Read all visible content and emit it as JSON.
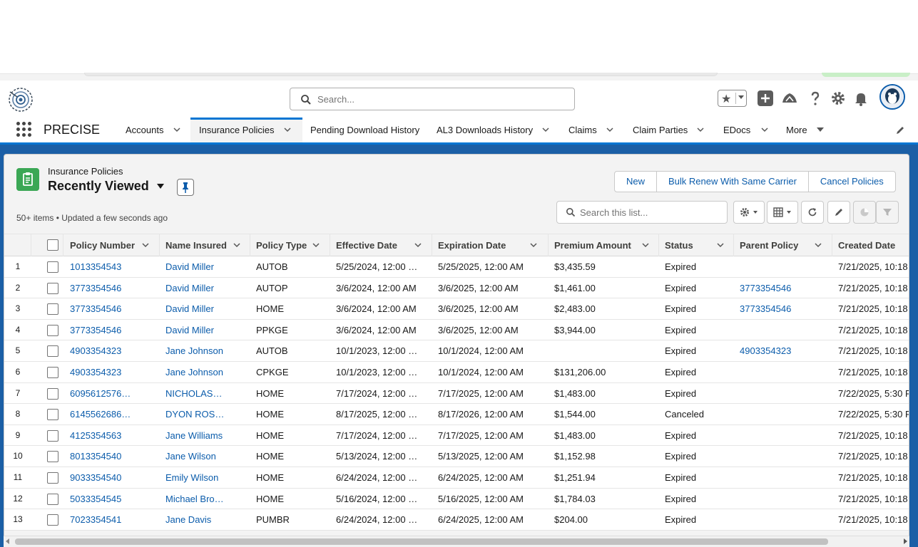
{
  "header": {
    "search_placeholder": "Search...",
    "icons": [
      "star-icon",
      "add-icon",
      "trailhead-icon",
      "help-icon",
      "setup-gear-icon",
      "notifications-bell-icon",
      "avatar"
    ]
  },
  "nav": {
    "app_name": "PRECISE",
    "items": [
      {
        "label": "Accounts",
        "has_menu": true,
        "active": false
      },
      {
        "label": "Insurance Policies",
        "has_menu": true,
        "active": true
      },
      {
        "label": "Pending Download History",
        "has_menu": false,
        "active": false
      },
      {
        "label": "AL3 Downloads History",
        "has_menu": true,
        "active": false
      },
      {
        "label": "Claims",
        "has_menu": true,
        "active": false
      },
      {
        "label": "Claim Parties",
        "has_menu": true,
        "active": false
      },
      {
        "label": "EDocs",
        "has_menu": true,
        "active": false
      },
      {
        "label": "More",
        "has_menu": true,
        "active": false
      }
    ]
  },
  "list": {
    "object_label": "Insurance Policies",
    "view_name": "Recently Viewed",
    "meta": "50+ items • Updated a few seconds ago",
    "buttons": [
      "New",
      "Bulk Renew With Same Carrier",
      "Cancel Policies"
    ],
    "search_placeholder": "Search this list...",
    "columns": [
      "Policy Number",
      "Name Insured",
      "Policy Type",
      "Effective Date",
      "Expiration Date",
      "Premium Amount",
      "Status",
      "Parent Policy",
      "Created Date"
    ],
    "rows": [
      {
        "n": "1",
        "policy": "1013354543",
        "insured": "David Miller",
        "type": "AUTOB",
        "eff": "5/25/2024, 12:00 …",
        "exp": "5/25/2025, 12:00 AM",
        "premium": "$3,435.59",
        "status": "Expired",
        "parent": "",
        "created": "7/21/2025, 10:18"
      },
      {
        "n": "2",
        "policy": "3773354546",
        "insured": "David Miller",
        "type": "AUTOP",
        "eff": "3/6/2024, 12:00 AM",
        "exp": "3/6/2025, 12:00 AM",
        "premium": "$1,461.00",
        "status": "Expired",
        "parent": "3773354546",
        "created": "7/21/2025, 10:18"
      },
      {
        "n": "3",
        "policy": "3773354546",
        "insured": "David Miller",
        "type": "HOME",
        "eff": "3/6/2024, 12:00 AM",
        "exp": "3/6/2025, 12:00 AM",
        "premium": "$2,483.00",
        "status": "Expired",
        "parent": "3773354546",
        "created": "7/21/2025, 10:18"
      },
      {
        "n": "4",
        "policy": "3773354546",
        "insured": "David Miller",
        "type": "PPKGE",
        "eff": "3/6/2024, 12:00 AM",
        "exp": "3/6/2025, 12:00 AM",
        "premium": "$3,944.00",
        "status": "Expired",
        "parent": "",
        "created": "7/21/2025, 10:18"
      },
      {
        "n": "5",
        "policy": "4903354323",
        "insured": "Jane Johnson",
        "type": "AUTOB",
        "eff": "10/1/2023, 12:00 …",
        "exp": "10/1/2024, 12:00 AM",
        "premium": "",
        "status": "Expired",
        "parent": "4903354323",
        "created": "7/21/2025, 10:18"
      },
      {
        "n": "6",
        "policy": "4903354323",
        "insured": "Jane Johnson",
        "type": "CPKGE",
        "eff": "10/1/2023, 12:00 …",
        "exp": "10/1/2024, 12:00 AM",
        "premium": "$131,206.00",
        "status": "Expired",
        "parent": "",
        "created": "7/21/2025, 10:18"
      },
      {
        "n": "7",
        "policy": "6095612576…",
        "insured": "NICHOLAS…",
        "type": "HOME",
        "eff": "7/17/2024, 12:00 …",
        "exp": "7/17/2025, 12:00 AM",
        "premium": "$1,483.00",
        "status": "Expired",
        "parent": "",
        "created": "7/22/2025, 5:30 P"
      },
      {
        "n": "8",
        "policy": "6145562686…",
        "insured": "DYON ROS…",
        "type": "HOME",
        "eff": "8/17/2025, 12:00 …",
        "exp": "8/17/2026, 12:00 AM",
        "premium": "$1,544.00",
        "status": "Canceled",
        "parent": "",
        "created": "7/22/2025, 5:30 P"
      },
      {
        "n": "9",
        "policy": "4125354563",
        "insured": "Jane Williams",
        "type": "HOME",
        "eff": "7/17/2024, 12:00 …",
        "exp": "7/17/2025, 12:00 AM",
        "premium": "$1,483.00",
        "status": "Expired",
        "parent": "",
        "created": "7/21/2025, 10:18"
      },
      {
        "n": "10",
        "policy": "8013354540",
        "insured": "Jane Wilson",
        "type": "HOME",
        "eff": "5/13/2024, 12:00 …",
        "exp": "5/13/2025, 12:00 AM",
        "premium": "$1,152.98",
        "status": "Expired",
        "parent": "",
        "created": "7/21/2025, 10:18"
      },
      {
        "n": "11",
        "policy": "9033354540",
        "insured": "Emily Wilson",
        "type": "HOME",
        "eff": "6/24/2024, 12:00 …",
        "exp": "6/24/2025, 12:00 AM",
        "premium": "$1,251.94",
        "status": "Expired",
        "parent": "",
        "created": "7/21/2025, 10:18"
      },
      {
        "n": "12",
        "policy": "5033354545",
        "insured": "Michael Bro…",
        "type": "HOME",
        "eff": "5/16/2024, 12:00 …",
        "exp": "5/16/2025, 12:00 AM",
        "premium": "$1,784.03",
        "status": "Expired",
        "parent": "",
        "created": "7/21/2025, 10:18"
      },
      {
        "n": "13",
        "policy": "7023354541",
        "insured": "Jane Davis",
        "type": "PUMBR",
        "eff": "6/24/2024, 12:00 …",
        "exp": "6/24/2025, 12:00 AM",
        "premium": "$204.00",
        "status": "Expired",
        "parent": "",
        "created": "7/21/2025, 10:18"
      }
    ]
  },
  "colors": {
    "brand_blue": "#0176d3",
    "link": "#0b5cab",
    "object_icon_green": "#3ba755",
    "backdrop_blue": "#1b5fa6"
  }
}
